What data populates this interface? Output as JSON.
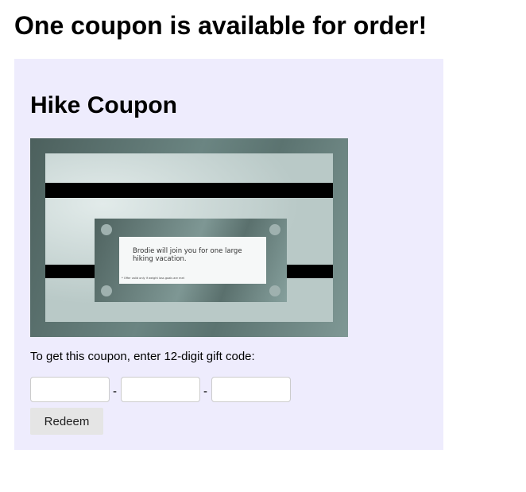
{
  "page": {
    "title": "One coupon is available for order!"
  },
  "coupon": {
    "title": "Hike Coupon",
    "image": {
      "message": "Brodie will join you for one large hiking vacation.",
      "fine_print": "* Offer valid only if weight loss goals are met"
    },
    "instruction": "To get this coupon, enter 12-digit gift code:",
    "code_fields": [
      {
        "value": "",
        "placeholder": ""
      },
      {
        "value": "",
        "placeholder": ""
      },
      {
        "value": "",
        "placeholder": ""
      }
    ],
    "separator": "-",
    "redeem_label": "Redeem"
  }
}
